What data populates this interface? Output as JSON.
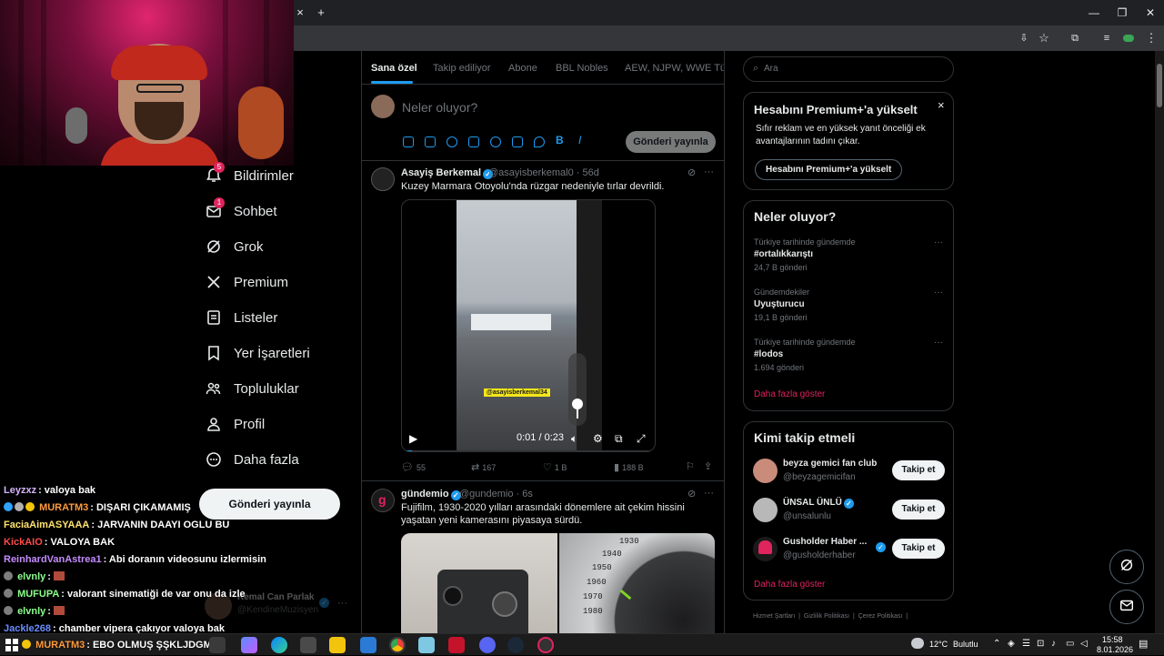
{
  "browser": {
    "close_tab": "×",
    "new_tab": "+",
    "minimize": "—",
    "restore": "❐",
    "close_window": "✕"
  },
  "nav": {
    "items": [
      {
        "label": "Bildirimler",
        "icon": "bell-icon",
        "badge": "5"
      },
      {
        "label": "Sohbet",
        "icon": "mail-icon",
        "badge": "1"
      },
      {
        "label": "Grok",
        "icon": "grok-icon"
      },
      {
        "label": "Premium",
        "icon": "x-logo-icon"
      },
      {
        "label": "Listeler",
        "icon": "list-icon"
      },
      {
        "label": "Yer İşaretleri",
        "icon": "bookmark-icon"
      },
      {
        "label": "Topluluklar",
        "icon": "communities-icon"
      },
      {
        "label": "Profil",
        "icon": "profile-icon"
      },
      {
        "label": "Daha fazla",
        "icon": "more-circle-icon"
      }
    ],
    "post_button": "Gönderi yayınla",
    "user": {
      "name": "Kemal Can Parlak",
      "handle": "@KendineMuzisyen",
      "more": "···"
    }
  },
  "chat": [
    {
      "user": "Leyzxz",
      "color": "#d6b4ff",
      "message": ": valoya bak",
      "badges": []
    },
    {
      "user": "MURATM3",
      "color": "#ff9b3d",
      "message": ": DIŞARI ÇIKAMAMIŞ",
      "badges": [
        "#2ea3ff",
        "#b0b0b0",
        "#f2c40c"
      ]
    },
    {
      "user": "FaciaAimASYAAA",
      "color": "#ffe36e",
      "message": ": JARVANIN DAAYI OGLU BU",
      "badges": []
    },
    {
      "user": "KickAIO",
      "color": "#ff4b4b",
      "message": ": VALOYA BAK",
      "badges": []
    },
    {
      "user": "ReinhardVanAstrea1",
      "color": "#c58cff",
      "message": ": Abi doranın videosunu izlermisin",
      "badges": []
    },
    {
      "user": "elvnly",
      "color": "#8bff8b",
      "message": ":",
      "badges": [
        "#7d7d7d"
      ],
      "emote": true
    },
    {
      "user": "MUFUPA",
      "color": "#8bff8b",
      "message": ": valorant sinematiği de var onu da izle",
      "badges": [
        "#7d7d7d"
      ]
    },
    {
      "user": "elvnly",
      "color": "#8bff8b",
      "message": ":",
      "badges": [
        "#7d7d7d"
      ],
      "emote": true
    },
    {
      "user": "Jackle268",
      "color": "#6b8cff",
      "message": ": chamber vipera çakıyor valoya bak",
      "badges": []
    },
    {
      "user": "MURATM3",
      "color": "#ff9b3d",
      "message": ": EBO OLMUŞ ŞŞKLJDGM",
      "badges": [
        "#f2c40c"
      ]
    }
  ],
  "feed": {
    "tabs": [
      "Sana özel",
      "Takip ediliyor",
      "Abone",
      "BBL Nobles",
      "AEW, NJPW, WWE Türki"
    ],
    "compose_placeholder": "Neler oluyor?",
    "compose_post_button": "Gönderi yayınla",
    "tweets": [
      {
        "name": "Asayiş Berkemal",
        "handle": "@asayisberkemal0 · 56d",
        "text": "Kuzey Marmara Otoyolu'nda rüzgar nedeniyle tırlar devrildi.",
        "video_tag": "@asayisberkemal34",
        "video_time": "0:01 / 0:23",
        "video_progress": 0.04,
        "volume_level": 0.25,
        "replies": "55",
        "retweets": "167",
        "likes": "1 B",
        "views": "188 B"
      },
      {
        "name": "gündemio",
        "handle": "@gundemio · 6s",
        "text": "Fujifilm, 1930-2020 yılları arasındaki dönemlere ait çekim hissini yaşatan yeni kamerasını piyasaya sürdü.",
        "dial_numbers": [
          "1930",
          "1940",
          "1950",
          "1960",
          "1970",
          "1980"
        ]
      }
    ]
  },
  "sidebar": {
    "search_placeholder": "Ara",
    "premium": {
      "title": "Hesabını Premium+'a yükselt",
      "body": "Sıfır reklam ve en yüksek yanıt önceliği ek avantajlarının tadını çıkar.",
      "button": "Hesabını Premium+'a yükselt",
      "close": "×"
    },
    "trends": {
      "title": "Neler oluyor?",
      "items": [
        {
          "category": "Türkiye tarihinde gündemde",
          "name": "#ortalıkkarıştı",
          "count": "24,7 B gönderi"
        },
        {
          "category": "Gündemdekiler",
          "name": "Uyuşturucu",
          "count": "19,1 B gönderi"
        },
        {
          "category": "Türkiye tarihinde gündemde",
          "name": "#lodos",
          "count": "1.694 gönderi"
        }
      ],
      "show_more": "Daha fazla göster"
    },
    "who_to_follow": {
      "title": "Kimi takip etmeli",
      "items": [
        {
          "name": "beyza gemici fan club",
          "handle": "@beyzagemicifan",
          "button": "Takip et"
        },
        {
          "name": "ÜNSAL ÜNLÜ",
          "handle": "@unsalunlu",
          "button": "Takip et"
        },
        {
          "name": "Gusholder Haber ...",
          "handle": "@gusholderhaber",
          "button": "Takip et"
        }
      ],
      "show_more": "Daha fazla göster"
    },
    "footer": [
      "Hizmet Şartları",
      "Gizlilik Politikası",
      "Çerez Politikası"
    ]
  },
  "taskbar": {
    "weather_temp": "12°C",
    "weather_text": "Bulutlu",
    "time": "15:58",
    "date": "8.01.2026"
  }
}
